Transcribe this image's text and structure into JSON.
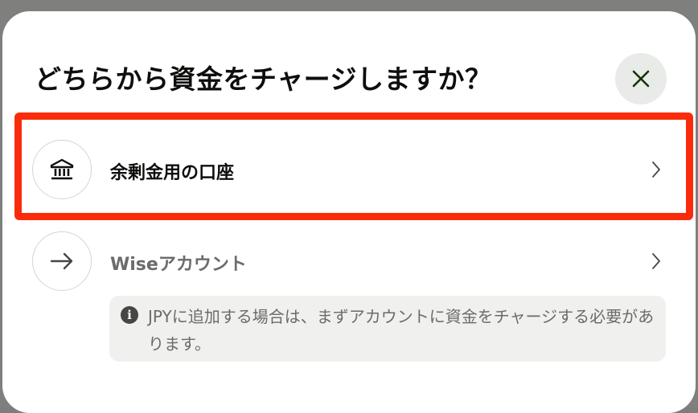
{
  "dialog": {
    "title": "どちらから資金をチャージしますか？",
    "close_icon": "close-icon"
  },
  "options": [
    {
      "label": "余剰金用の口座",
      "icon": "bank-icon",
      "chevron_icon": "chevron-right-icon",
      "highlighted": true
    },
    {
      "label": "Wiseアカウント",
      "icon": "arrow-right-icon",
      "chevron_icon": "chevron-right-icon",
      "highlighted": false
    }
  ],
  "info": {
    "icon": "info-icon",
    "icon_glyph": "i",
    "text": "JPYに追加する場合は、まずアカウントに資金をチャージする必要があります。"
  },
  "colors": {
    "highlight": "#fa2b0a",
    "close_button_bg": "#e9ebe8",
    "info_bg": "#f0f0ef",
    "text_primary": "#0e0f0c",
    "text_muted": "#6a6c6a"
  }
}
